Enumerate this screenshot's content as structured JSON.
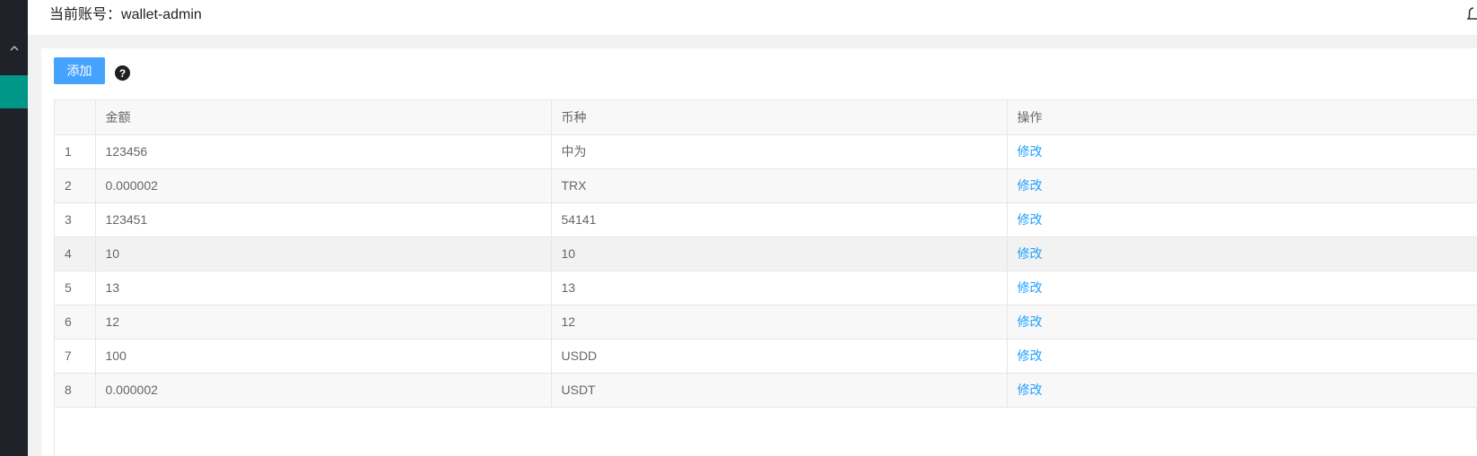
{
  "header": {
    "account_label": "当前账号：",
    "account_name": "wallet-admin"
  },
  "toolbar": {
    "add_label": "添加",
    "help_glyph": "?"
  },
  "table": {
    "columns": [
      "",
      "金额",
      "币种",
      "操作"
    ],
    "rows": [
      {
        "index": "1",
        "amount": "123456",
        "currency": "中为",
        "action": "修改"
      },
      {
        "index": "2",
        "amount": "0.000002",
        "currency": "TRX",
        "action": "修改"
      },
      {
        "index": "3",
        "amount": "123451",
        "currency": "54141",
        "action": "修改"
      },
      {
        "index": "4",
        "amount": "10",
        "currency": "10",
        "action": "修改"
      },
      {
        "index": "5",
        "amount": "13",
        "currency": "13",
        "action": "修改"
      },
      {
        "index": "6",
        "amount": "12",
        "currency": "12",
        "action": "修改"
      },
      {
        "index": "7",
        "amount": "100",
        "currency": "USDD",
        "action": "修改"
      },
      {
        "index": "8",
        "amount": "0.000002",
        "currency": "USDT",
        "action": "修改"
      }
    ]
  },
  "colors": {
    "sidebar_bg": "#20222a",
    "sidebar_active": "#009688",
    "primary_button": "#46a2ff",
    "link": "#1e9fff"
  },
  "icons": {
    "sidebar_toggle": "chevron-up-icon",
    "notification": "bell-icon",
    "help": "question-circle-icon"
  }
}
